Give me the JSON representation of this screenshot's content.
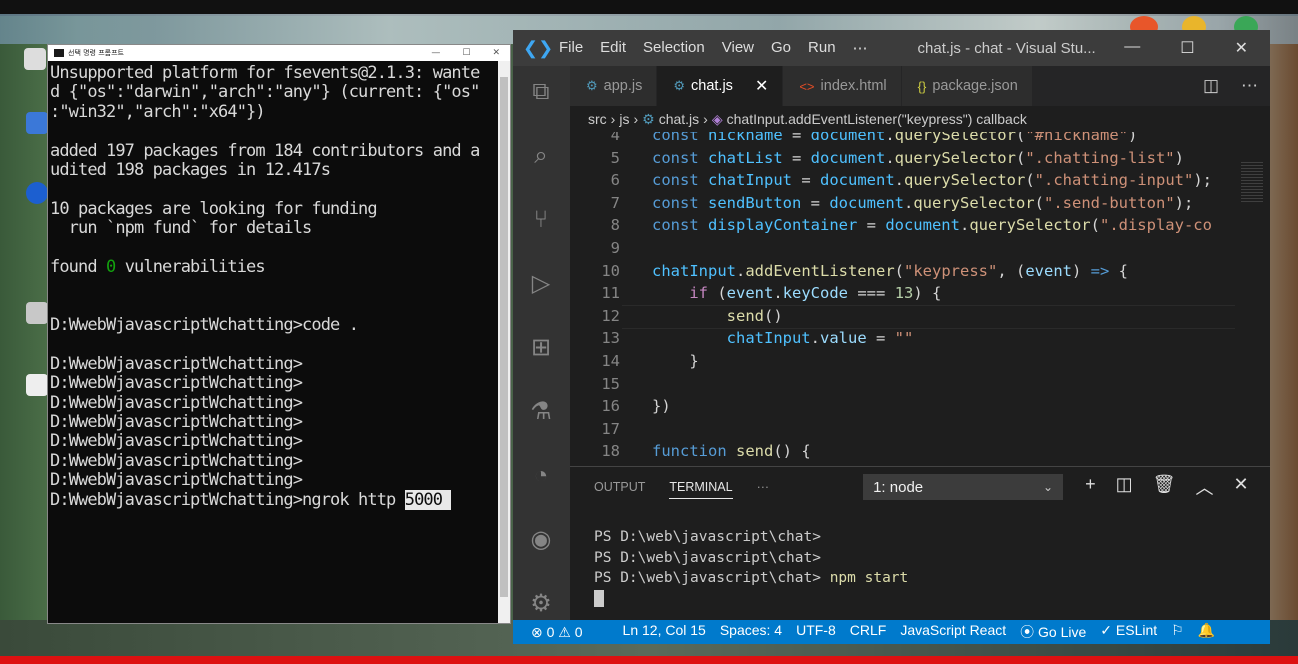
{
  "cmd": {
    "title": "선택 명령 프롬프트",
    "lines": [
      {
        "text": "Unsupported platform for fsevents@2.1.3: wante"
      },
      {
        "text": "d {\"os\":\"darwin\",\"arch\":\"any\"} (current: {\"os\""
      },
      {
        "text": ":\"win32\",\"arch\":\"x64\"})"
      },
      {
        "text": ""
      },
      {
        "text": "added 197 packages from 184 contributors and a"
      },
      {
        "text": "udited 198 packages in 12.417s"
      },
      {
        "text": ""
      },
      {
        "text": "10 packages are looking for funding"
      },
      {
        "text": "  run `npm fund` for details"
      },
      {
        "text": ""
      },
      {
        "text_pre": "found ",
        "text_green": "0",
        "text_post": " vulnerabilities"
      },
      {
        "text": ""
      },
      {
        "text": ""
      },
      {
        "text": "D:WwebWjavascriptWchatting>code ."
      },
      {
        "text": ""
      },
      {
        "text": "D:WwebWjavascriptWchatting>"
      },
      {
        "text": "D:WwebWjavascriptWchatting>"
      },
      {
        "text": "D:WwebWjavascriptWchatting>"
      },
      {
        "text": "D:WwebWjavascriptWchatting>"
      },
      {
        "text": "D:WwebWjavascriptWchatting>"
      },
      {
        "text": "D:WwebWjavascriptWchatting>"
      },
      {
        "text": "D:WwebWjavascriptWchatting>"
      },
      {
        "text_pre": "D:WwebWjavascriptWchatting>ngrok http ",
        "text_sel": "5000 "
      }
    ]
  },
  "vscode": {
    "menu": [
      "File",
      "Edit",
      "Selection",
      "View",
      "Go",
      "Run",
      "⋯"
    ],
    "window_title": "chat.js - chat - Visual Stu...",
    "tabs": [
      {
        "label": "app.js",
        "icon": "gear-icon",
        "glyph": "⚙",
        "color": "#519aba",
        "active": false
      },
      {
        "label": "chat.js",
        "icon": "gear-icon",
        "glyph": "⚙",
        "color": "#519aba",
        "active": true
      },
      {
        "label": "index.html",
        "icon": "html-icon",
        "glyph": "<>",
        "color": "#e44d26",
        "active": false
      },
      {
        "label": "package.json",
        "icon": "json-icon",
        "glyph": "{}",
        "color": "#cbcb41",
        "active": false
      }
    ],
    "breadcrumb": {
      "src": "src",
      "js": "js",
      "file": "chat.js",
      "symbol": "chatInput.addEventListener(\"keypress\") callback"
    },
    "code": [
      {
        "n": "4",
        "tokens": [
          [
            "kw",
            "const "
          ],
          [
            "var",
            "nickname"
          ],
          [
            "pl",
            " = "
          ],
          [
            "var",
            "document"
          ],
          [
            "pl",
            "."
          ],
          [
            "fn",
            "querySelector"
          ],
          [
            "pl",
            "("
          ],
          [
            "str",
            "\"#nickname\""
          ],
          [
            "pl",
            ")"
          ]
        ]
      },
      {
        "n": "5",
        "tokens": [
          [
            "kw",
            "const "
          ],
          [
            "var",
            "chatList"
          ],
          [
            "pl",
            " = "
          ],
          [
            "var",
            "document"
          ],
          [
            "pl",
            "."
          ],
          [
            "fn",
            "querySelector"
          ],
          [
            "pl",
            "("
          ],
          [
            "str",
            "\".chatting-list\""
          ],
          [
            "pl",
            ")"
          ]
        ]
      },
      {
        "n": "6",
        "tokens": [
          [
            "kw",
            "const "
          ],
          [
            "var",
            "chatInput"
          ],
          [
            "pl",
            " = "
          ],
          [
            "var",
            "document"
          ],
          [
            "pl",
            "."
          ],
          [
            "fn",
            "querySelector"
          ],
          [
            "pl",
            "("
          ],
          [
            "str",
            "\".chatting-input\""
          ],
          [
            "pl",
            ");"
          ]
        ]
      },
      {
        "n": "7",
        "tokens": [
          [
            "kw",
            "const "
          ],
          [
            "var",
            "sendButton"
          ],
          [
            "pl",
            " = "
          ],
          [
            "var",
            "document"
          ],
          [
            "pl",
            "."
          ],
          [
            "fn",
            "querySelector"
          ],
          [
            "pl",
            "("
          ],
          [
            "str",
            "\".send-button\""
          ],
          [
            "pl",
            ");"
          ]
        ]
      },
      {
        "n": "8",
        "tokens": [
          [
            "kw",
            "const "
          ],
          [
            "var",
            "displayContainer"
          ],
          [
            "pl",
            " = "
          ],
          [
            "var",
            "document"
          ],
          [
            "pl",
            "."
          ],
          [
            "fn",
            "querySelector"
          ],
          [
            "pl",
            "("
          ],
          [
            "str",
            "\".display-co"
          ]
        ]
      },
      {
        "n": "9",
        "tokens": []
      },
      {
        "n": "10",
        "tokens": [
          [
            "var",
            "chatInput"
          ],
          [
            "pl",
            "."
          ],
          [
            "fn",
            "addEventListener"
          ],
          [
            "pl",
            "("
          ],
          [
            "str",
            "\"keypress\""
          ],
          [
            "pl",
            ", ("
          ],
          [
            "prop",
            "event"
          ],
          [
            "pl",
            ") "
          ],
          [
            "kw",
            "=>"
          ],
          [
            "pl",
            " {"
          ]
        ]
      },
      {
        "n": "11",
        "tokens": [
          [
            "pl",
            "    "
          ],
          [
            "ctl",
            "if"
          ],
          [
            "pl",
            " ("
          ],
          [
            "prop",
            "event"
          ],
          [
            "pl",
            "."
          ],
          [
            "prop",
            "keyCode"
          ],
          [
            "pl",
            " === "
          ],
          [
            "num",
            "13"
          ],
          [
            "pl",
            ") {"
          ]
        ]
      },
      {
        "n": "12",
        "tokens": [
          [
            "pl",
            "        "
          ],
          [
            "fn",
            "send"
          ],
          [
            "pl",
            "()"
          ]
        ]
      },
      {
        "n": "13",
        "tokens": [
          [
            "pl",
            "        "
          ],
          [
            "var",
            "chatInput"
          ],
          [
            "pl",
            "."
          ],
          [
            "prop",
            "value"
          ],
          [
            "pl",
            " = "
          ],
          [
            "str",
            "\"\""
          ]
        ]
      },
      {
        "n": "14",
        "tokens": [
          [
            "pl",
            "    }"
          ]
        ]
      },
      {
        "n": "15",
        "tokens": []
      },
      {
        "n": "16",
        "tokens": [
          [
            "pl",
            "})"
          ]
        ]
      },
      {
        "n": "17",
        "tokens": []
      },
      {
        "n": "18",
        "tokens": [
          [
            "kw",
            "function "
          ],
          [
            "fn",
            "send"
          ],
          [
            "pl",
            "() {"
          ]
        ]
      }
    ],
    "panel": {
      "tabs": [
        "OUTPUT",
        "TERMINAL",
        "···"
      ],
      "active_tab": "TERMINAL",
      "terminal_select": "1: node",
      "lines": [
        {
          "prompt": "PS D:\\web\\javascript\\chat>",
          "cmd": ""
        },
        {
          "prompt": "PS D:\\web\\javascript\\chat>",
          "cmd": ""
        },
        {
          "prompt": "PS D:\\web\\javascript\\chat> ",
          "cmd": "npm start"
        }
      ]
    },
    "status": {
      "problems": "⊗ 0 ⚠ 0",
      "position": "Ln 12, Col 15",
      "spaces": "Spaces: 4",
      "encoding": "UTF-8",
      "eol": "CRLF",
      "language": "JavaScript React",
      "golive": "Go Live",
      "eslint": "✓ ESLint"
    }
  }
}
